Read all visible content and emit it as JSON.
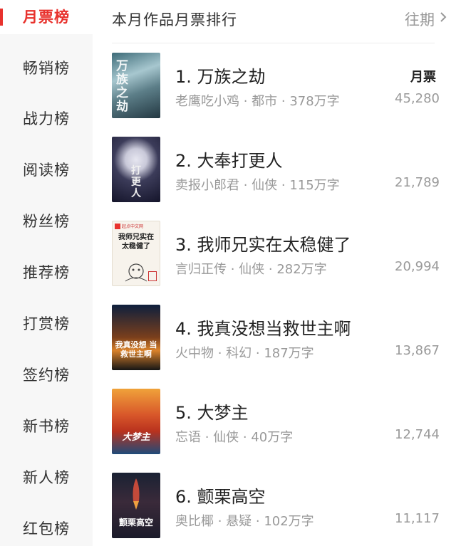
{
  "sidebar": {
    "items": [
      {
        "label": "月票榜"
      },
      {
        "label": "畅销榜"
      },
      {
        "label": "战力榜"
      },
      {
        "label": "阅读榜"
      },
      {
        "label": "粉丝榜"
      },
      {
        "label": "推荐榜"
      },
      {
        "label": "打赏榜"
      },
      {
        "label": "签约榜"
      },
      {
        "label": "新书榜"
      },
      {
        "label": "新人榜"
      },
      {
        "label": "红包榜"
      }
    ],
    "active_index": 0
  },
  "header": {
    "title": "本月作品月票排行",
    "history_link": "往期",
    "history_icon": "chevron-right-icon"
  },
  "list": {
    "column_label": "月票",
    "books": [
      {
        "title": "1. 万族之劫",
        "meta": "老鹰吃小鸡 · 都市 · 378万字",
        "votes": "45,280",
        "cover_text": "万族之劫"
      },
      {
        "title": "2. 大奉打更人",
        "meta": "卖报小郎君 · 仙侠 · 115万字",
        "votes": "21,789",
        "cover_text": "打更人"
      },
      {
        "title": "3. 我师兄实在太稳健了",
        "meta": "言归正传 · 仙侠 · 282万字",
        "votes": "20,994",
        "cover_text": "我师兄实在 太稳健了",
        "cover_publisher": "起点中文网"
      },
      {
        "title": "4. 我真没想当救世主啊",
        "meta": "火中物 · 科幻 · 187万字",
        "votes": "13,867",
        "cover_text": "我真没想 当救世主啊"
      },
      {
        "title": "5. 大梦主",
        "meta": "忘语 · 仙侠 · 40万字",
        "votes": "12,744",
        "cover_text": "大梦主"
      },
      {
        "title": "6. 颤栗高空",
        "meta": "奥比椰 · 悬疑 · 102万字",
        "votes": "11,117",
        "cover_text": "颤栗高空"
      }
    ]
  },
  "colors": {
    "accent": "#e8322d",
    "text_primary": "#222222",
    "text_secondary": "#999999",
    "sidebar_bg": "#f7f7f7"
  }
}
